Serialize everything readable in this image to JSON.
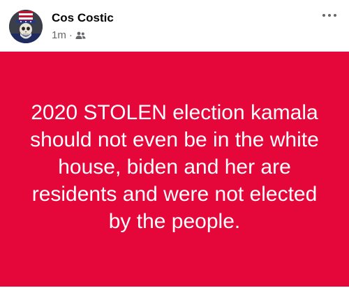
{
  "post": {
    "author": "Cos Costic",
    "timestamp": "1m",
    "separator": "·",
    "audience_icon": "friends-icon",
    "avatar_icon": "uncle-sam-skull-avatar",
    "more_icon": "more-options-icon",
    "text": "2020 STOLEN election kamala should not even be in the white house, biden and her are residents and were not elected by the people.",
    "background_color": "#e5063a",
    "text_color": "#ffffff"
  }
}
